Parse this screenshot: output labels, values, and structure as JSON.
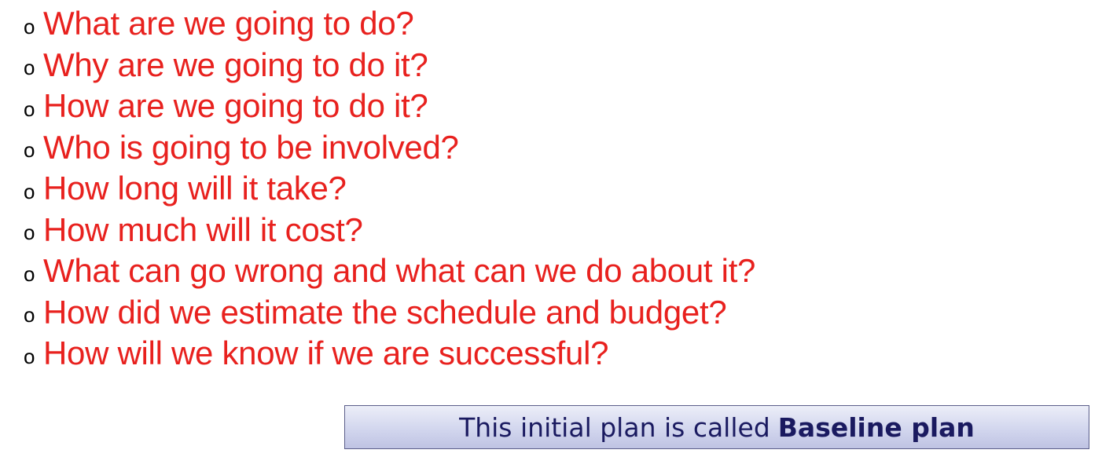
{
  "questions": [
    "What are we going to do?",
    "Why are we going to do it?",
    "How are we going to do it?",
    "Who is going to be involved?",
    "How long will it take?",
    "How much will it cost?",
    "What can go wrong and what can we do about it?",
    "How did we estimate the schedule and budget?",
    "How will we know if we are successful?"
  ],
  "bullet_glyph": "o",
  "baseline": {
    "prefix": "This initial plan is called",
    "bold": "Baseline plan"
  },
  "colors": {
    "question_text": "#e8211e",
    "box_border": "#5b5e8a",
    "box_text": "#1a1a60"
  }
}
